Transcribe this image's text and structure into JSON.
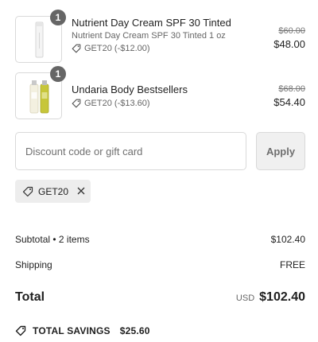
{
  "items": [
    {
      "quantity": "1",
      "name": "Nutrient Day Cream SPF 30 Tinted",
      "variant": "Nutrient Day Cream SPF 30 Tinted 1 oz",
      "discount": "GET20 (-$12.00)",
      "original_price": "$60.00",
      "price": "$48.00",
      "thumbnail_icon": "cream-tube-image"
    },
    {
      "quantity": "1",
      "name": "Undaria Body Bestsellers",
      "variant": "",
      "discount": "GET20 (-$13.60)",
      "original_price": "$68.00",
      "price": "$54.40",
      "thumbnail_icon": "body-bottles-image"
    }
  ],
  "discount": {
    "placeholder": "Discount code or gift card",
    "value": "",
    "apply_label": "Apply",
    "applied_code": "GET20"
  },
  "summary": {
    "subtotal_label": "Subtotal • 2 items",
    "subtotal_value": "$102.40",
    "shipping_label": "Shipping",
    "shipping_value": "FREE",
    "total_label": "Total",
    "currency": "USD",
    "total_value": "$102.40",
    "savings_label": "TOTAL SAVINGS",
    "savings_value": "$25.60"
  },
  "colors": {
    "badge": "#666666",
    "chip_bg": "#ededed",
    "apply_bg": "#f0f0f0",
    "border": "#d9d9d9"
  }
}
